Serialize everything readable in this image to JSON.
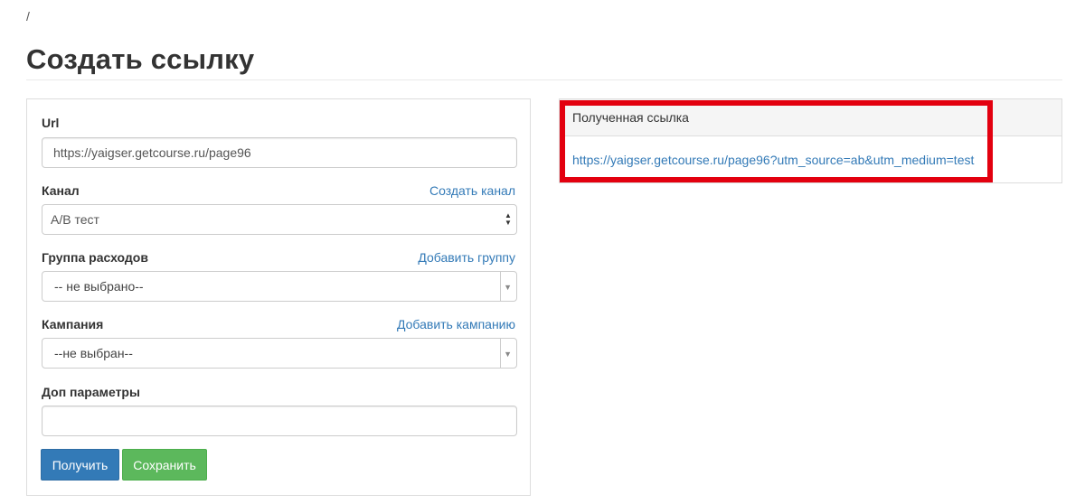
{
  "breadcrumb": "/",
  "page": {
    "title": "Создать ссылку"
  },
  "form": {
    "url": {
      "label": "Url",
      "value": "https://yaigser.getcourse.ru/page96"
    },
    "channel": {
      "label": "Канал",
      "link": "Создать канал",
      "value": "A/B тест"
    },
    "expense_group": {
      "label": "Группа расходов",
      "link": "Добавить группу",
      "value": "-- не выбрано--"
    },
    "campaign": {
      "label": "Кампания",
      "link": "Добавить кампанию",
      "value": "--не выбран--"
    },
    "extra_params": {
      "label": "Доп параметры",
      "value": ""
    },
    "get_button": "Получить",
    "save_button": "Сохранить"
  },
  "result": {
    "header": "Полученная ссылка",
    "link": "https://yaigser.getcourse.ru/page96?utm_source=ab&utm_medium=test"
  },
  "colors": {
    "link": "#337ab7",
    "primary_button": "#337ab7",
    "success_button": "#5cb85c",
    "highlight": "#e3000f"
  },
  "icons": {
    "select_arrows": "up-down-arrows-icon",
    "dropdown_caret": "caret-down-icon"
  }
}
